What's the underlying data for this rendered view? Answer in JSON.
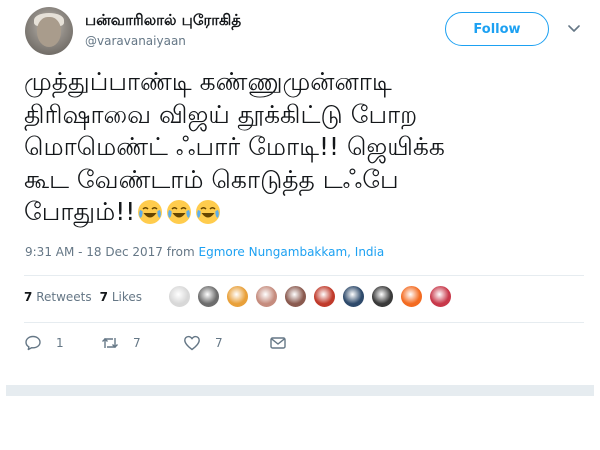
{
  "user": {
    "name": "பன்வாரிலால் புரோகித்",
    "handle": "@varavanaiyaan"
  },
  "follow_label": "Follow",
  "tweet": {
    "lines": [
      "முத்துப்பாண்டி கண்ணுமுன்னாடி",
      "திரிஷாவை விஜய் தூக்கிட்டு போற",
      "மொமெண்ட் ஃபார் மோடி!!  ஜெயிக்க",
      "கூட வேண்டாம் கொடுத்த டஃபே",
      "போதும்!!"
    ],
    "emojis": [
      "face-with-tears-of-joy",
      "face-with-tears-of-joy",
      "face-with-tears-of-joy"
    ]
  },
  "meta": {
    "time": "9:31 AM - 18 Dec 2017 from ",
    "location": "Egmore Nungambakkam, India"
  },
  "stats": {
    "retweets_count": "7",
    "retweets_label": "Retweets",
    "likes_count": "7",
    "likes_label": "Likes"
  },
  "likers": [
    {
      "color": "#d8d8d8"
    },
    {
      "color": "#6d6d6d"
    },
    {
      "color": "#e8a03a"
    },
    {
      "color": "#c58c7e"
    },
    {
      "color": "#8a5a4f"
    },
    {
      "color": "#c03a2b"
    },
    {
      "color": "#2e4a6b"
    },
    {
      "color": "#3a3a3a"
    },
    {
      "color": "#f36b21"
    },
    {
      "color": "#c8384a"
    }
  ],
  "actions": {
    "reply_count": "1",
    "retweet_count": "7",
    "like_count": "7"
  },
  "colors": {
    "accent": "#1da1f2",
    "secondary_text": "#657786",
    "divider": "#e6ecf0"
  }
}
